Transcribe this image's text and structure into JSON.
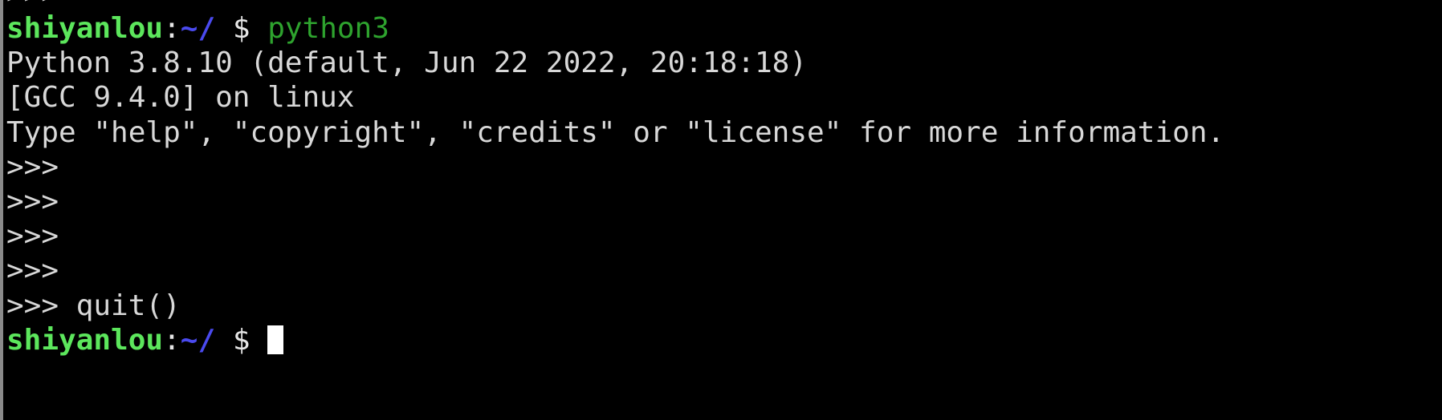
{
  "terminal": {
    "background_color": "#000000",
    "default_text_color": "#d8d8d8",
    "user_color": "#5ce65c",
    "path_color": "#4a4aef",
    "command_color": "#2ea32e",
    "cursor_color": "#ffffff",
    "border_color": "#8a8a8a"
  },
  "prompt": {
    "user": "shiyanlou",
    "colon": ":",
    "path": "~/",
    "space": " ",
    "dollar": "$",
    "trailing_space": " "
  },
  "python_prompt": ">>>",
  "lines": {
    "scrolled_top": ">>>",
    "command": "python3",
    "banner_1": "Python 3.8.10 (default, Jun 22 2022, 20:18:18)",
    "banner_2": "[GCC 9.4.0] on linux",
    "banner_3": "Type \"help\", \"copyright\", \"credits\" or \"license\" for more information.",
    "empty_prompt_1": ">>>",
    "empty_prompt_2": ">>>",
    "empty_prompt_3": ">>>",
    "empty_prompt_4": ">>>",
    "quit_prompt": ">>>",
    "quit_command": " quit()"
  }
}
